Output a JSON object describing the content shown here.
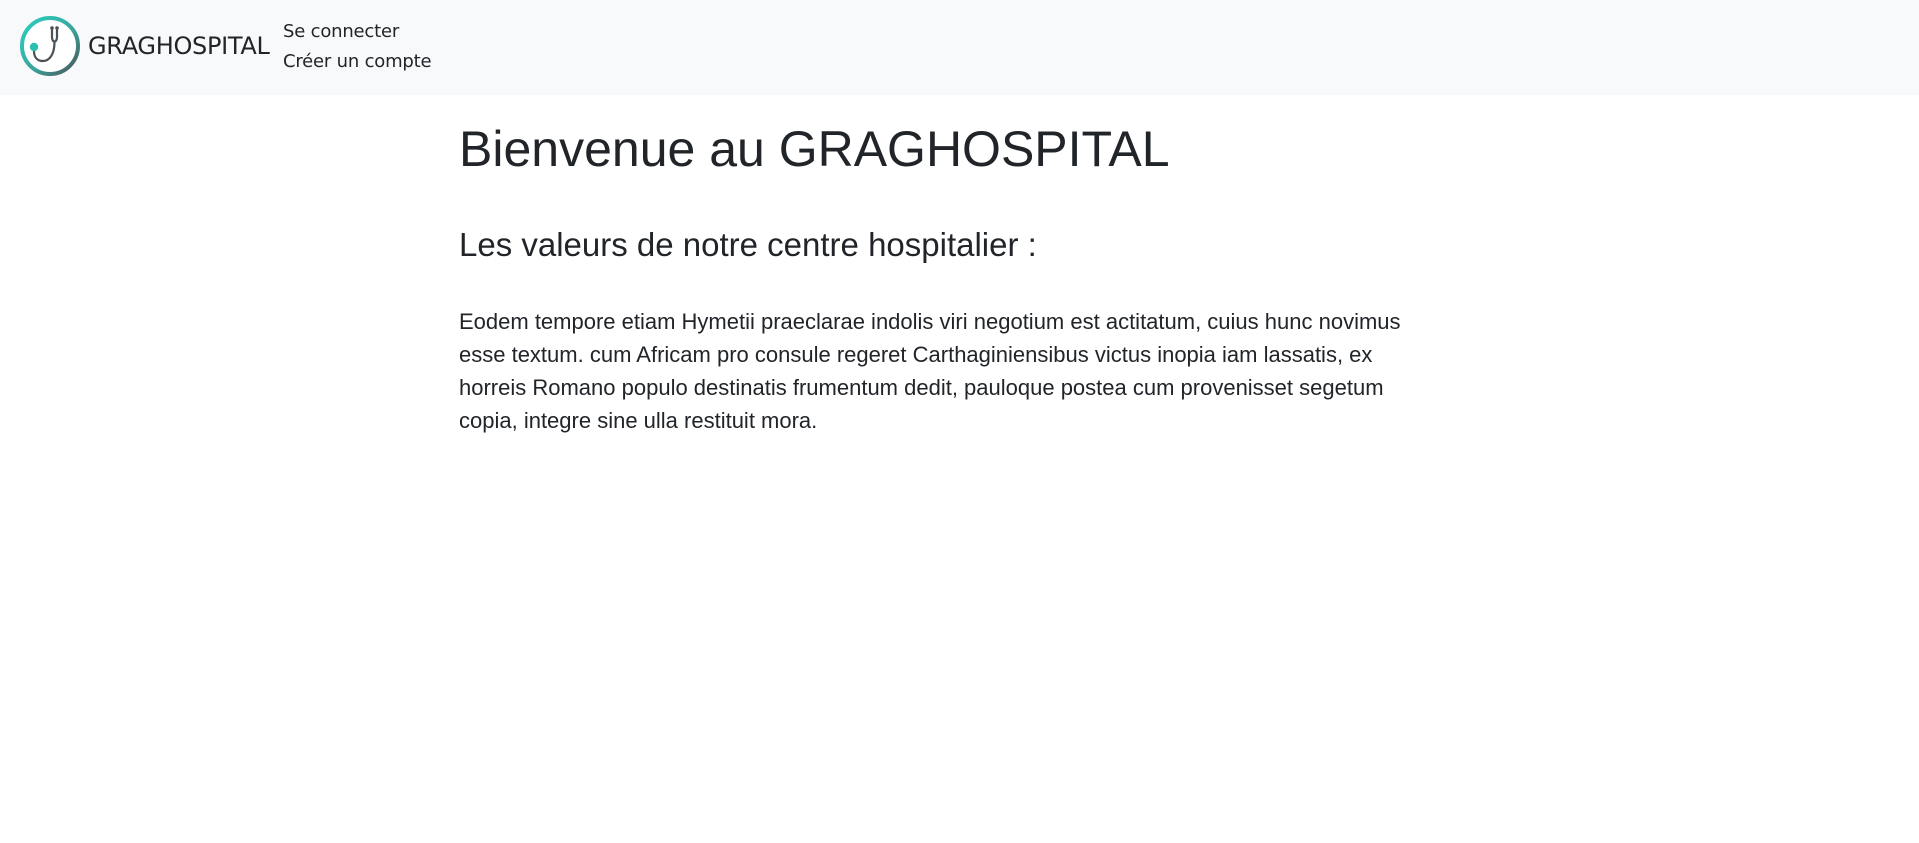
{
  "navbar": {
    "brand": "GRAGHOSPITAL",
    "logo_icon": "stethoscope-icon",
    "links": [
      {
        "label": "Se connecter"
      },
      {
        "label": "Créer un compte"
      }
    ]
  },
  "main": {
    "title": "Bienvenue au GRAGHOSPITAL",
    "subtitle": "Les valeurs de notre centre hospitalier :",
    "paragraph": "Eodem tempore etiam Hymetii praeclarae indolis viri negotium est actitatum, cuius hunc novimus esse textum. cum Africam pro consule regeret Carthaginiensibus victus inopia iam lassatis, ex horreis Romano populo destinatis frumentum dedit, pauloque postea cum provenisset segetum copia, integre sine ulla restituit mora."
  },
  "colors": {
    "navbar_bg": "#f8f9fa",
    "text": "#212529",
    "logo_teal": "#2bbfb0",
    "logo_dark": "#4a5257"
  }
}
